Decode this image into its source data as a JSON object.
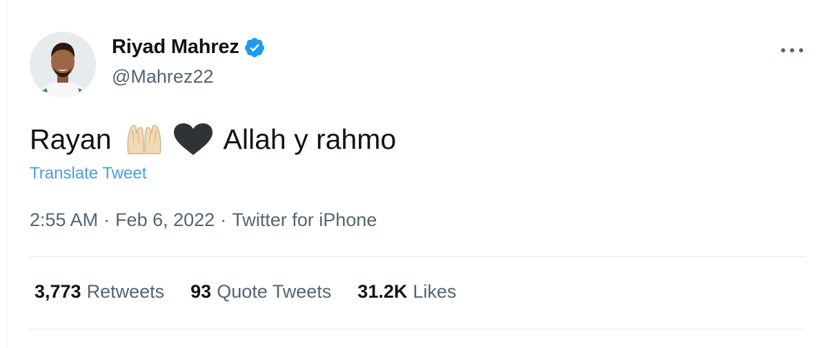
{
  "author": {
    "display_name": "Riyad Mahrez",
    "handle": "@Mahrez22",
    "verified_icon": "verified-badge-icon"
  },
  "tweet": {
    "text_before": "Rayan",
    "emoji_1": "folded-hands-icon",
    "emoji_2": "black-heart-icon",
    "text_after": "Allah y rahmo",
    "translate_label": "Translate Tweet"
  },
  "meta": {
    "time": "2:55 AM",
    "separator": "·",
    "date": "Feb 6, 2022",
    "source": "Twitter for iPhone"
  },
  "stats": [
    {
      "value": "3,773",
      "label": "Retweets"
    },
    {
      "value": "93",
      "label": "Quote Tweets"
    },
    {
      "value": "31.2K",
      "label": "Likes"
    }
  ],
  "colors": {
    "link_blue": "#4a9be6",
    "verified_blue": "#1d9bf0",
    "secondary_text": "#536471",
    "primary_text": "#0f1419"
  }
}
